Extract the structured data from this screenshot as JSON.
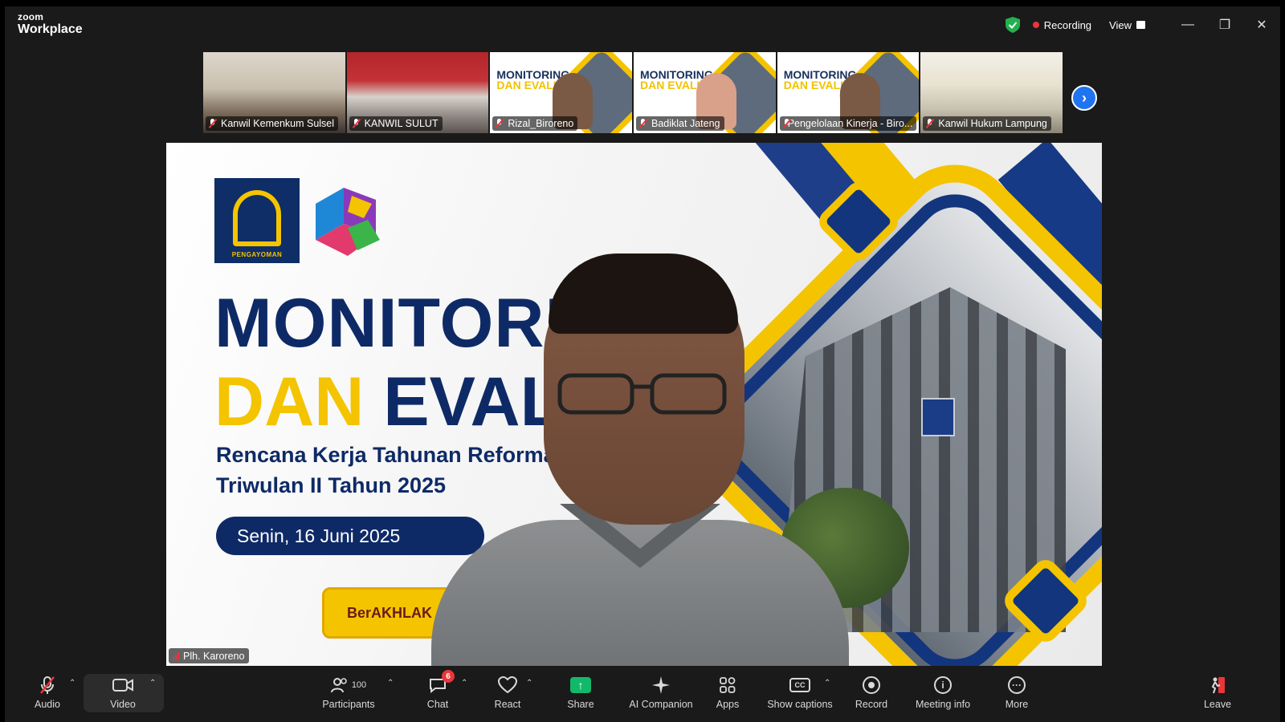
{
  "titlebar": {
    "brand_top": "zoom",
    "brand_bottom": "Workplace",
    "recording_label": "Recording",
    "view_label": "View",
    "minimize": "—",
    "restore": "❐",
    "close": "✕"
  },
  "gallery": {
    "tiles": [
      {
        "name": "Kanwil Kemenkum Sulsel"
      },
      {
        "name": "KANWIL SULUT"
      },
      {
        "name": "Rizal_Biroreno"
      },
      {
        "name": "Badiklat Jateng"
      },
      {
        "name": "Pengelolaan Kinerja - Biro..."
      },
      {
        "name": "Kanwil Hukum Lampung"
      }
    ],
    "mini_slide_title_1": "MONITORING",
    "mini_slide_title_2": "DAN EVALU",
    "next_arrow": "›"
  },
  "speaker": {
    "name": "Plh. Karoreno",
    "slide": {
      "logo_text": "PENGAYOMAN",
      "title_line1": "MONITORI",
      "title_line2_a": "DAN ",
      "title_line2_b": "EVALU",
      "subtitle_line1": "Rencana Kerja Tahunan Reforma",
      "subtitle_line2": "Triwulan II Tahun 2025",
      "date": "Senin, 16 Juni 2025",
      "badge_text": "BerAKHLAK",
      "badge_hashtag": "#"
    }
  },
  "toolbar": {
    "audio_label": "Audio",
    "video_label": "Video",
    "participants_label": "Participants",
    "participants_count": "100",
    "chat_label": "Chat",
    "chat_badge": "6",
    "react_label": "React",
    "share_label": "Share",
    "ai_label": "AI Companion",
    "apps_label": "Apps",
    "captions_label": "Show captions",
    "record_label": "Record",
    "info_label": "Meeting info",
    "more_label": "More",
    "leave_label": "Leave"
  },
  "colors": {
    "recording_dot": "#e8363b",
    "share_green": "#12b96a",
    "accent_blue": "#1f74f0",
    "slide_navy": "#0e2a66",
    "slide_yellow": "#f4c400"
  }
}
